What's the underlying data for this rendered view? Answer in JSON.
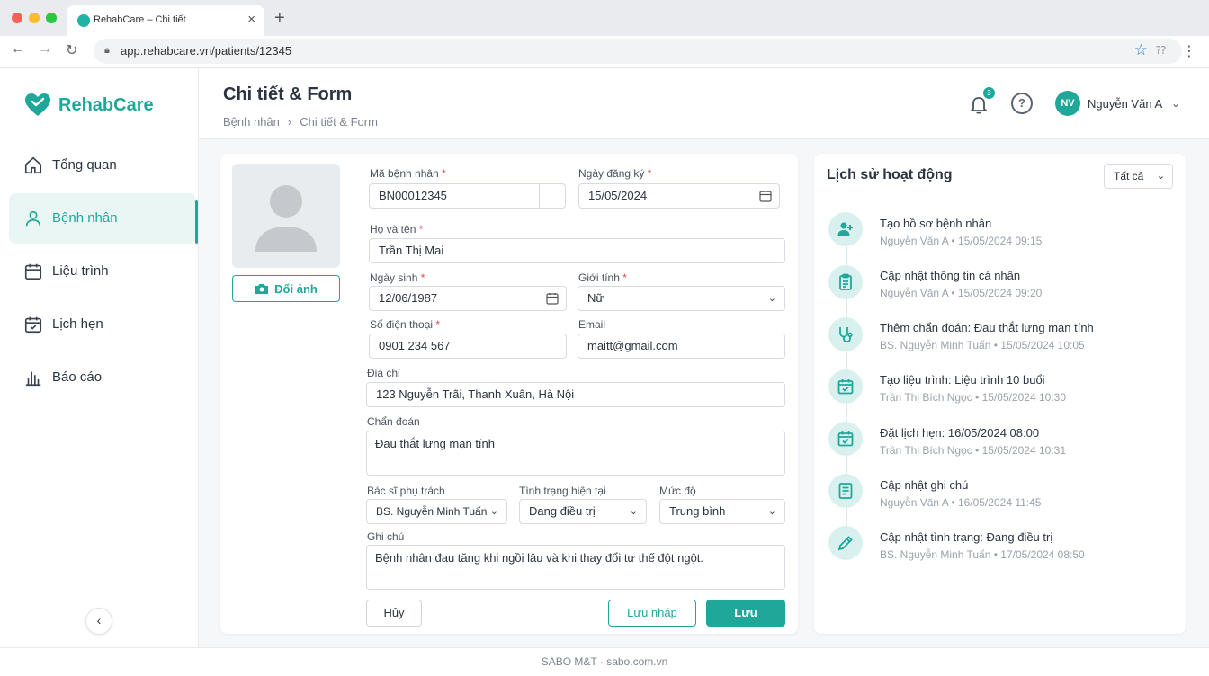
{
  "browser": {
    "tab_title": "RehabCare – Chi tiết",
    "url": "app.rehabcare.vn/patients/12345"
  },
  "brand": {
    "name": "RehabCare",
    "accent": "#1fa89a"
  },
  "sidebar": {
    "items": [
      {
        "label": "Tổng quan",
        "icon": "home-icon"
      },
      {
        "label": "Bệnh nhân",
        "icon": "user-icon",
        "active": true
      },
      {
        "label": "Liệu trình",
        "icon": "calendar-icon"
      },
      {
        "label": "Lịch hẹn",
        "icon": "calendar-check-icon"
      },
      {
        "label": "Báo cáo",
        "icon": "bar-chart-icon"
      }
    ]
  },
  "header": {
    "title": "Chi tiết & Form",
    "breadcrumb": [
      "Bệnh nhân",
      "Chi tiết & Form"
    ],
    "notifications": "3",
    "help": "?",
    "avatar_initials": "NV",
    "user_name": "Nguyễn Văn A"
  },
  "form": {
    "change_photo": "Đổi ảnh",
    "patient_id_label": "Mã bệnh nhân",
    "patient_id": "BN00012345",
    "reg_date_label": "Ngày đăng ký",
    "reg_date": "15/05/2024",
    "name_label": "Họ và tên",
    "name": "Trần Thị Mai",
    "dob_label": "Ngày sinh",
    "dob": "12/06/1987",
    "gender_label": "Giới tính",
    "gender": "Nữ",
    "phone_label": "Số điện thoại",
    "phone": "0901 234 567",
    "email_label": "Email",
    "email": "maitt@gmail.com",
    "address_label": "Địa chỉ",
    "address": "123 Nguyễn Trãi, Thanh Xuân, Hà Nội",
    "diagnosis_label": "Chẩn đoán",
    "diagnosis": "Đau thắt lưng mạn tính",
    "doctor_label": "Bác sĩ phụ trách",
    "doctor": "BS. Nguyễn Minh Tuấn",
    "status_label": "Tình trạng hiện tại",
    "status": "Đang điều trị",
    "level_label": "Mức độ",
    "level": "Trung bình",
    "note_label": "Ghi chú",
    "note": "Bệnh nhân đau tăng khi ngồi lâu và khi thay đổi tư thế đột ngột.",
    "required_mark": "*",
    "cancel": "Hủy",
    "draft": "Lưu nháp",
    "save": "Lưu"
  },
  "activity": {
    "title": "Lịch sử hoạt động",
    "filter": "Tất cả",
    "items": [
      {
        "text": "Tạo hồ sơ bệnh nhân",
        "user": "Nguyễn Văn A",
        "time": "15/05/2024 09:15",
        "icon": "user-plus-icon"
      },
      {
        "text": "Cập nhật thông tin cá nhân",
        "user": "Nguyễn Văn A",
        "time": "15/05/2024 09:20",
        "icon": "clipboard-icon"
      },
      {
        "text": "Thêm chẩn đoán: Đau thắt lưng mạn tính",
        "user": "BS. Nguyễn Minh Tuấn",
        "time": "15/05/2024 10:05",
        "icon": "stethoscope-icon"
      },
      {
        "text": "Tạo liệu trình: Liệu trình 10 buổi",
        "user": "Trần Thị Bích Ngọc",
        "time": "15/05/2024 10:30",
        "icon": "calendar-check-icon"
      },
      {
        "text": "Đặt lịch hẹn: 16/05/2024 08:00",
        "user": "Trần Thị Bích Ngọc",
        "time": "15/05/2024 10:31",
        "icon": "calendar-check-icon"
      },
      {
        "text": "Cập nhật ghi chú",
        "user": "Nguyễn Văn A",
        "time": "16/05/2024 11:45",
        "icon": "document-icon"
      },
      {
        "text": "Cập nhật tình trạng: Đang điều trị",
        "user": "BS. Nguyễn Minh Tuấn",
        "time": "17/05/2024 08:50",
        "icon": "pencil-icon"
      }
    ]
  },
  "footer": {
    "text": "SABO M&T · sabo.com.vn"
  }
}
